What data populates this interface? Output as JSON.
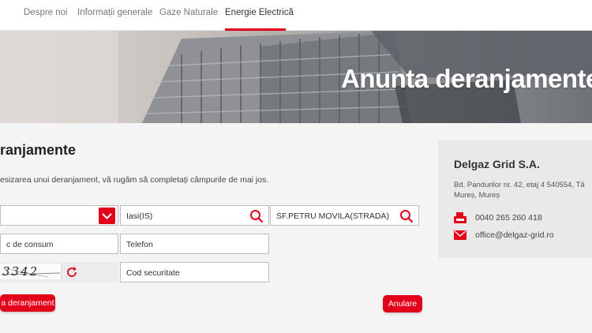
{
  "nav": {
    "items": [
      {
        "label": "Despre noi"
      },
      {
        "label": "Informații generale"
      },
      {
        "label": "Gaze Naturale"
      },
      {
        "label": "Energie Electrică"
      }
    ],
    "active_index": 3
  },
  "hero": {
    "title": "Anunta deranjamente"
  },
  "form": {
    "title": "ranjamente",
    "intro": "esizarea unui deranjament, vă rugăm să completați câmpurile de mai jos.",
    "county_value": "",
    "city_value": "Iasi(IS)",
    "street_value": "SF.PETRU MOVILA(STRADA)",
    "consumption_value": "c de consum",
    "phone_value": "Telefon",
    "captcha_text": "3342",
    "security_value": "Cod securitate",
    "submit_label": "a deranjament",
    "cancel_label": "Anulare"
  },
  "contact": {
    "company": "Delgaz Grid S.A.",
    "address_line1": "Bd. Pandurilor nr. 42, etaj 4 540554, Tâ",
    "address_line2": "Mureș, Mureș",
    "phone": "0040 265 260 418",
    "email": "office@delgaz-grid.ro"
  },
  "colors": {
    "accent": "#e2001a"
  },
  "icons": [
    "chevron-down-icon",
    "search-icon",
    "refresh-icon",
    "fax-phone-icon",
    "envelope-icon"
  ]
}
